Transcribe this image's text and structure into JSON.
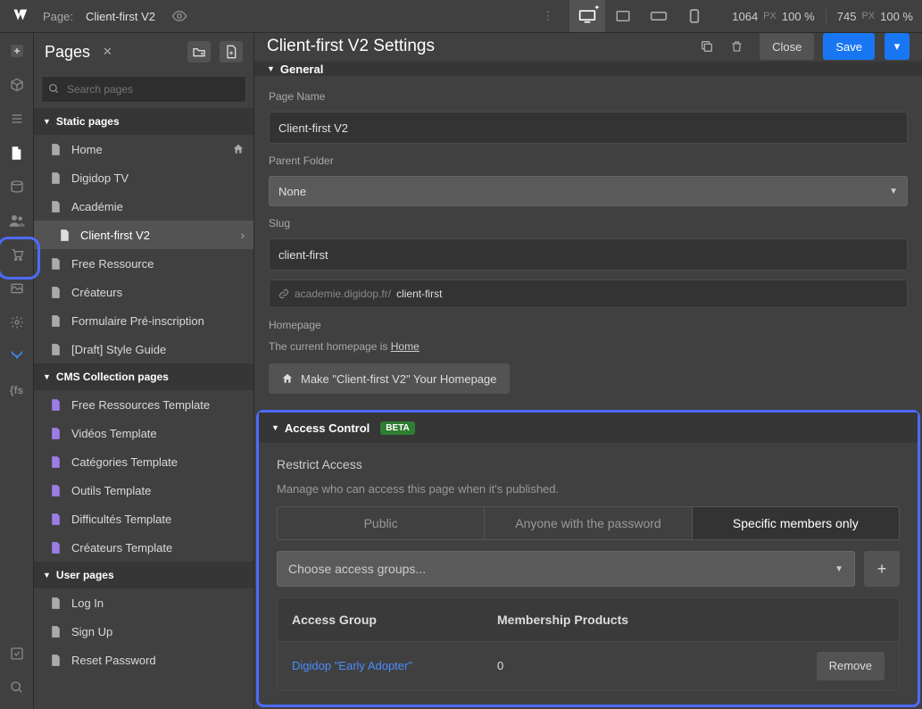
{
  "topbar": {
    "page_label": "Page:",
    "page_name": "Client-first V2",
    "width": "1064",
    "height": "745",
    "px": "PX",
    "pct1": "100 %",
    "pct2": "100 %"
  },
  "pages": {
    "title": "Pages",
    "search_placeholder": "Search pages",
    "sections": {
      "static": "Static pages",
      "cms": "CMS Collection pages",
      "user": "User pages"
    },
    "static_items": [
      {
        "label": "Home",
        "home": true
      },
      {
        "label": "Digidop TV"
      },
      {
        "label": "Académie"
      },
      {
        "label": "Client-first V2",
        "active": true
      },
      {
        "label": "Free Ressource"
      },
      {
        "label": "Créateurs"
      },
      {
        "label": "Formulaire Pré-inscription"
      },
      {
        "label": "[Draft] Style Guide"
      }
    ],
    "cms_items": [
      {
        "label": "Free Ressources Template"
      },
      {
        "label": "Vidéos Template"
      },
      {
        "label": "Catégories Template"
      },
      {
        "label": "Outils Template"
      },
      {
        "label": "Difficultés Template"
      },
      {
        "label": "Créateurs Template"
      }
    ],
    "user_items": [
      {
        "label": "Log In"
      },
      {
        "label": "Sign Up"
      },
      {
        "label": "Reset Password"
      }
    ]
  },
  "settings": {
    "title": "Client-first V2 Settings",
    "close": "Close",
    "save": "Save",
    "general": "General",
    "page_name_label": "Page Name",
    "page_name_value": "Client-first V2",
    "parent_label": "Parent Folder",
    "parent_value": "None",
    "slug_label": "Slug",
    "slug_value": "client-first",
    "url_base": "academie.digidop.fr/",
    "url_slug": "client-first",
    "homepage_label": "Homepage",
    "homepage_text": "The current homepage is ",
    "homepage_link": "Home",
    "homepage_btn": "Make \"Client-first V2\" Your Homepage"
  },
  "access": {
    "title": "Access Control",
    "beta": "BETA",
    "restrict_title": "Restrict Access",
    "restrict_sub": "Manage who can access this page when it's published.",
    "opt_public": "Public",
    "opt_pwd": "Anyone with the password",
    "opt_members": "Specific members only",
    "group_placeholder": "Choose access groups...",
    "col_group": "Access Group",
    "col_products": "Membership Products",
    "row_group": "Digidop \"Early Adopter\"",
    "row_products": "0",
    "remove": "Remove"
  }
}
